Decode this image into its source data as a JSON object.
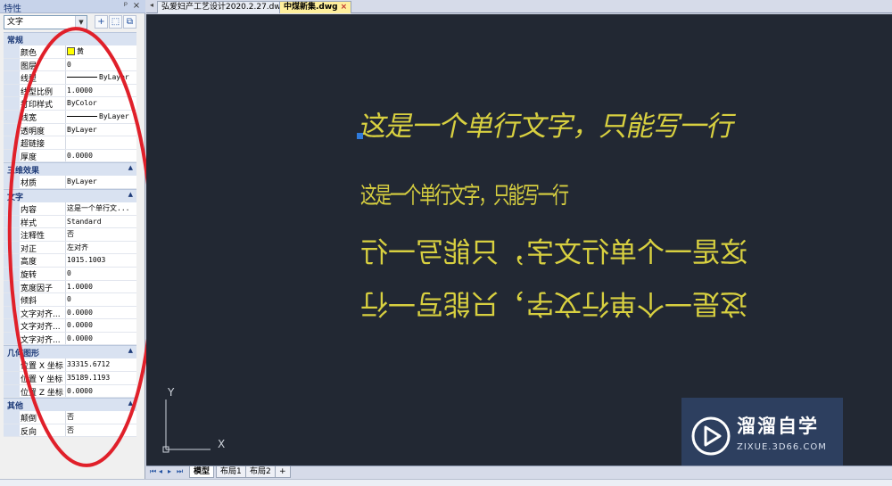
{
  "panel": {
    "title": "特性",
    "pin": "ᵖ",
    "close": "×",
    "object_type": "文字",
    "categories": [
      {
        "label": "常规",
        "rows": [
          {
            "key": "颜色",
            "value": "黄",
            "swatch": "#ffff00"
          },
          {
            "key": "图层",
            "value": "0"
          },
          {
            "key": "线型",
            "value": "ByLayer",
            "line": true
          },
          {
            "key": "线型比例",
            "value": "1.0000"
          },
          {
            "key": "打印样式",
            "value": "ByColor"
          },
          {
            "key": "线宽",
            "value": "ByLayer",
            "line": true
          },
          {
            "key": "透明度",
            "value": "ByLayer"
          },
          {
            "key": "超链接",
            "value": ""
          },
          {
            "key": "厚度",
            "value": "0.0000"
          }
        ]
      },
      {
        "label": "三维效果",
        "collapsible": true,
        "rows": [
          {
            "key": "材质",
            "value": "ByLayer"
          }
        ]
      },
      {
        "label": "文字",
        "collapsible": true,
        "rows": [
          {
            "key": "内容",
            "value": "这是一个单行文..."
          },
          {
            "key": "样式",
            "value": "Standard"
          },
          {
            "key": "注释性",
            "value": "否"
          },
          {
            "key": "对正",
            "value": "左对齐"
          },
          {
            "key": "高度",
            "value": "1015.1003"
          },
          {
            "key": "旋转",
            "value": "0"
          },
          {
            "key": "宽度因子",
            "value": "1.0000"
          },
          {
            "key": "倾斜",
            "value": "0"
          },
          {
            "key": "文字对齐...",
            "value": "0.0000"
          },
          {
            "key": "文字对齐...",
            "value": "0.0000"
          },
          {
            "key": "文字对齐...",
            "value": "0.0000"
          }
        ]
      },
      {
        "label": "几何图形",
        "collapsible": true,
        "rows": [
          {
            "key": "位置 X 坐标",
            "value": "33315.6712"
          },
          {
            "key": "位置 Y 坐标",
            "value": "35189.1193"
          },
          {
            "key": "位置 Z 坐标",
            "value": "0.0000"
          }
        ]
      },
      {
        "label": "其他",
        "collapsible": true,
        "rows": [
          {
            "key": "颠倒",
            "value": "否"
          },
          {
            "key": "反向",
            "value": "否"
          }
        ]
      }
    ]
  },
  "tabs": {
    "documents": [
      {
        "label": "弘爱妇产工艺设计2020.2.27.dwg",
        "active": false
      },
      {
        "label": "中煤新集.dwg",
        "active": true,
        "close": "×"
      }
    ],
    "layouts": [
      "模型",
      "布局1",
      "布局2",
      "+"
    ]
  },
  "canvas": {
    "text_lines": [
      "这是一个单行文字，只能写一行",
      "这是一个单行文字，只能写一行",
      "这是一个单行文字，只能写一行",
      "这是一个单行文字，只能写一行"
    ],
    "ucs_x": "X",
    "ucs_y": "Y",
    "text_color": "#d8d040",
    "background": "#222833"
  },
  "watermark": {
    "title": "溜溜自学",
    "site": "ZIXUE.3D66.COM"
  }
}
